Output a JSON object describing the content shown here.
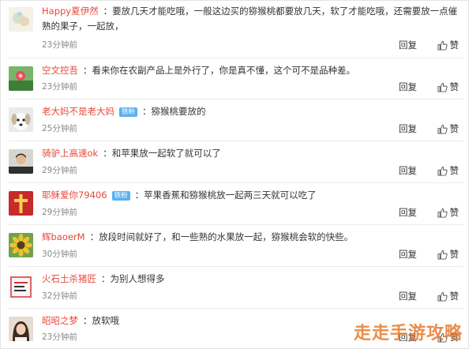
{
  "comments": [
    {
      "user": "Happy夏伊然",
      "badge": "",
      "text": "要放几天才能吃哦，一般这边买的猕猴桃都要放几天，软了才能吃哦，还需要放一点催熟的果子，一起放，",
      "time": "23分钟前",
      "reply": "回复",
      "like": "赞",
      "avatar": "bubble"
    },
    {
      "user": "空文控吾",
      "badge": "",
      "text": "看来你在农副产品上是外行了，你是真不懂，这个可不是品种差。",
      "time": "23分钟前",
      "reply": "回复",
      "like": "赞",
      "avatar": "flower"
    },
    {
      "user": "老大妈不是老大妈",
      "badge": "铁粉",
      "text": "猕猴桃要放的",
      "time": "25分钟前",
      "reply": "回复",
      "like": "赞",
      "avatar": "dog"
    },
    {
      "user": "骑驴上高速ok",
      "badge": "",
      "text": "和苹果放一起软了就可以了",
      "time": "29分钟前",
      "reply": "回复",
      "like": "赞",
      "avatar": "person"
    },
    {
      "user": "耶稣爱你79406",
      "badge": "铁粉",
      "text": "苹果香蕉和猕猴桃放一起两三天就可以吃了",
      "time": "29分钟前",
      "reply": "回复",
      "like": "赞",
      "avatar": "cross"
    },
    {
      "user": "辉baoerM",
      "badge": "",
      "text": "放段时间就好了，和一些熟的水果放一起，猕猴桃会软的快些。",
      "time": "30分钟前",
      "reply": "回复",
      "like": "赞",
      "avatar": "sunflower"
    },
    {
      "user": "火石土杀猪匠",
      "badge": "",
      "text": "为别人想得多",
      "time": "32分钟前",
      "reply": "回复",
      "like": "赞",
      "avatar": "text"
    },
    {
      "user": "昭昭之梦",
      "badge": "",
      "text": "放软哦",
      "time": "23分钟前",
      "reply": "回复",
      "like": "赞",
      "avatar": "girl"
    }
  ],
  "watermark": "走走手游攻略",
  "colors": {
    "username": "#e8493b",
    "badge": "#5ab0f0",
    "time": "#888888",
    "watermark": "#e8792b"
  }
}
